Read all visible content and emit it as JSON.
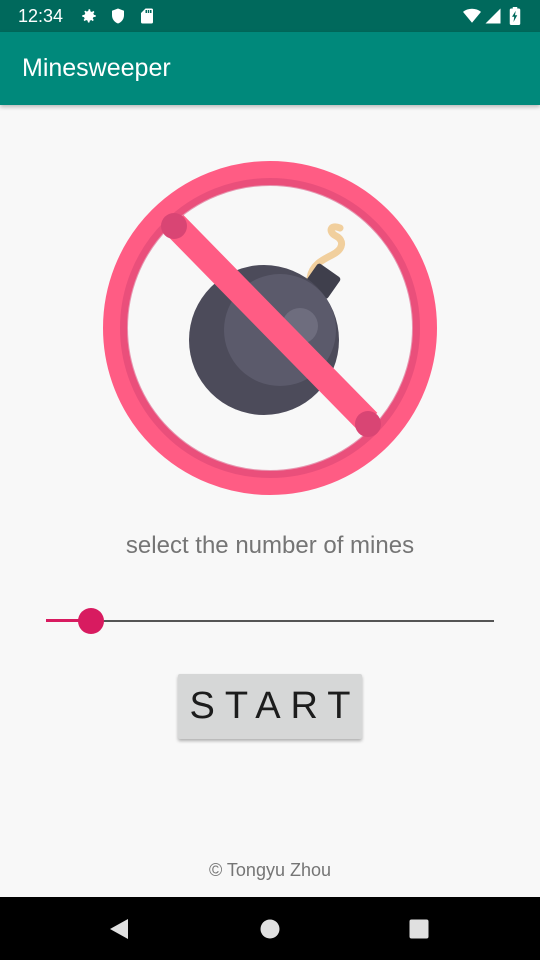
{
  "status_bar": {
    "time": "12:34",
    "icons_left": [
      "gear-icon",
      "shield-icon",
      "sd-card-icon"
    ],
    "icons_right": [
      "wifi-icon",
      "signal-icon",
      "battery-icon"
    ]
  },
  "app_bar": {
    "title": "Minesweeper",
    "color": "#00897b"
  },
  "main": {
    "illustration": "no-bomb-icon",
    "prompt": "select the number of mines",
    "slider": {
      "value_fraction": 0.1,
      "accent": "#d81b60"
    },
    "start_label": "START"
  },
  "footer": {
    "copyright": "© Tongyu Zhou"
  },
  "nav_bar": {
    "buttons": [
      "back-icon",
      "home-icon",
      "recents-icon"
    ]
  }
}
